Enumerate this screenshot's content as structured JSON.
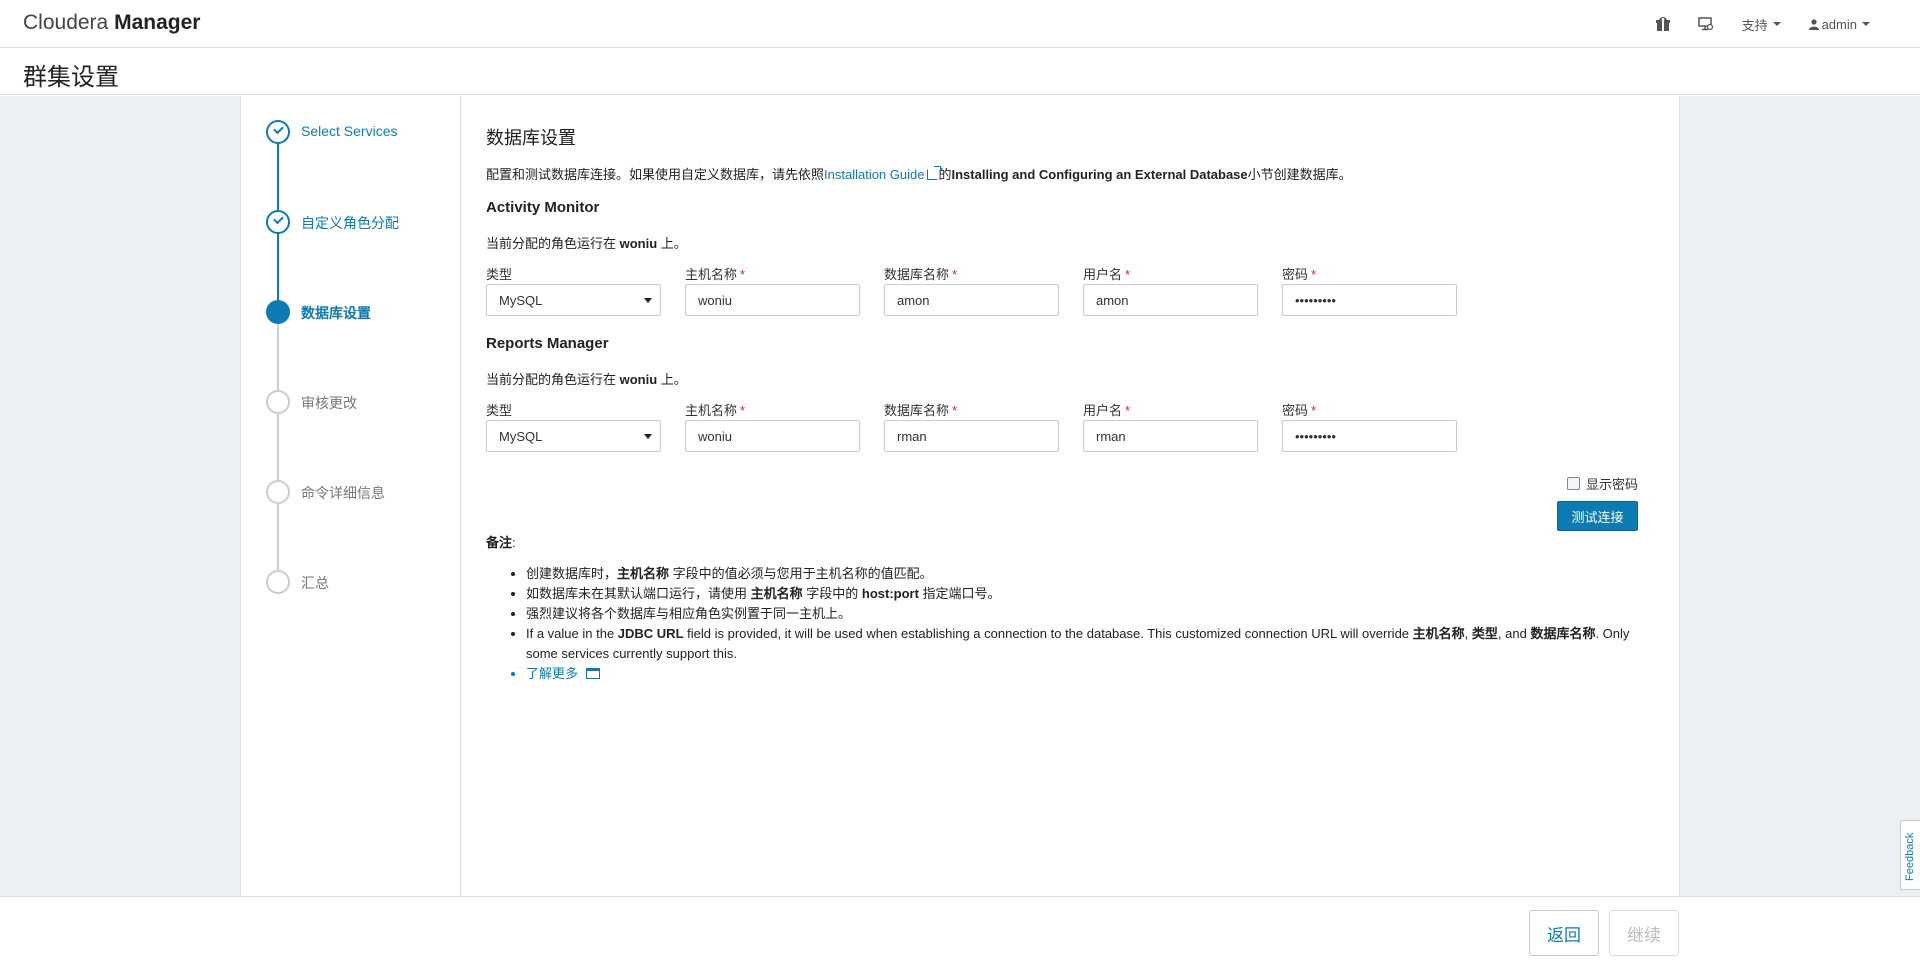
{
  "nav": {
    "brand_light": "Cloudera",
    "brand_bold": "Manager",
    "support_label": "支持",
    "user_label": "admin"
  },
  "page": {
    "title": "群集设置"
  },
  "steps": [
    {
      "label": "Select Services",
      "state": "done"
    },
    {
      "label": "自定义角色分配",
      "state": "done"
    },
    {
      "label": "数据库设置",
      "state": "active"
    },
    {
      "label": "审核更改",
      "state": "pending"
    },
    {
      "label": "命令详细信息",
      "state": "pending"
    },
    {
      "label": "汇总",
      "state": "pending"
    }
  ],
  "content": {
    "title": "数据库设置",
    "intro_before": "配置和测试数据库连接。如果使用自定义数据库，请先依照",
    "intro_link": "Installation Guide",
    "intro_mid": "的",
    "intro_bold": "Installing and Configuring an External Database",
    "intro_after": "小节创建数据库。",
    "labels": {
      "type": "类型",
      "host": "主机名称",
      "db": "数据库名称",
      "user": "用户名",
      "password": "密码",
      "req": "*"
    },
    "assigned_before": "当前分配的角色运行在 ",
    "assigned_after": " 上。",
    "sections": [
      {
        "name": "Activity Monitor",
        "host_assigned": "woniu",
        "type": "MySQL",
        "host": "woniu",
        "db": "amon",
        "user": "amon",
        "password": "•••••••••"
      },
      {
        "name": "Reports Manager",
        "host_assigned": "woniu",
        "type": "MySQL",
        "host": "woniu",
        "db": "rman",
        "user": "rman",
        "password": "•••••••••"
      }
    ],
    "show_password": "显示密码",
    "test_button": "测试连接",
    "notes_title": "备注",
    "notes_colon": ":",
    "notes": {
      "n1_a": "创建数据库时，",
      "n1_b": "主机名称",
      "n1_c": " 字段中的值必须与您用于主机名称的值匹配。",
      "n2_a": "如数据库未在其默认端口运行，请使用 ",
      "n2_b": "主机名称",
      "n2_c": " 字段中的 ",
      "n2_d": "host:port",
      "n2_e": " 指定端口号。",
      "n3": "强烈建议将各个数据库与相应角色实例置于同一主机上。",
      "n4_a": "If a value in the ",
      "n4_b": "JDBC URL",
      "n4_c": " field is provided, it will be used when establishing a connection to the database. This customized connection URL will override ",
      "n4_d": "主机名称",
      "n4_e": ", ",
      "n4_f": "类型",
      "n4_g": ", and ",
      "n4_h": "数据库名称",
      "n4_i": ". Only some services currently support this.",
      "learn_more": "了解更多"
    }
  },
  "footer": {
    "back": "返回",
    "next": "继续"
  },
  "feedback": "Feedback",
  "colors": {
    "accent": "#0d7bb3",
    "required": "#c9302c",
    "background": "#edf0f3"
  },
  "icons": [
    "gift-icon",
    "monitor-icon",
    "user-icon",
    "check-icon",
    "external-link-icon",
    "window-icon"
  ]
}
